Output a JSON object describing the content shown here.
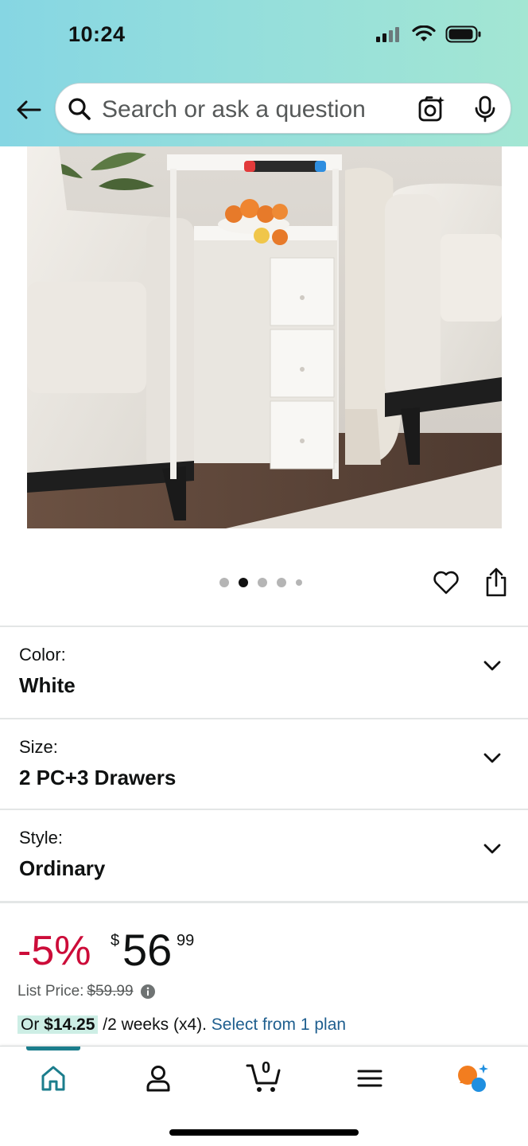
{
  "status_bar": {
    "time": "10:24"
  },
  "search": {
    "placeholder": "Search or ask a question"
  },
  "gallery": {
    "dot_count": 5,
    "active_index": 1
  },
  "variations": [
    {
      "label": "Color:",
      "value": "White"
    },
    {
      "label": "Size:",
      "value": "2 PC+3 Drawers"
    },
    {
      "label": "Style:",
      "value": "Ordinary"
    }
  ],
  "price": {
    "discount": "-5%",
    "currency": "$",
    "whole": "56",
    "fraction": "99",
    "list_label": "List Price:",
    "list_value": "$59.99"
  },
  "installment": {
    "prefix": "Or ",
    "amount": "$14.25",
    "term": " /2 weeks (x4). ",
    "link": "Select from 1 plan"
  },
  "cart": {
    "count": "0"
  },
  "colors": {
    "accent": "#1b7d8c",
    "discount": "#cc0c39",
    "link": "#1f5f8f",
    "installment_highlight": "#cdeee5"
  },
  "icons": [
    "back-arrow-icon",
    "search-icon",
    "camera-icon",
    "mic-icon",
    "heart-icon",
    "share-icon",
    "chevron-down-icon",
    "info-icon",
    "home-icon",
    "account-icon",
    "cart-icon",
    "menu-icon",
    "rufus-icon"
  ]
}
